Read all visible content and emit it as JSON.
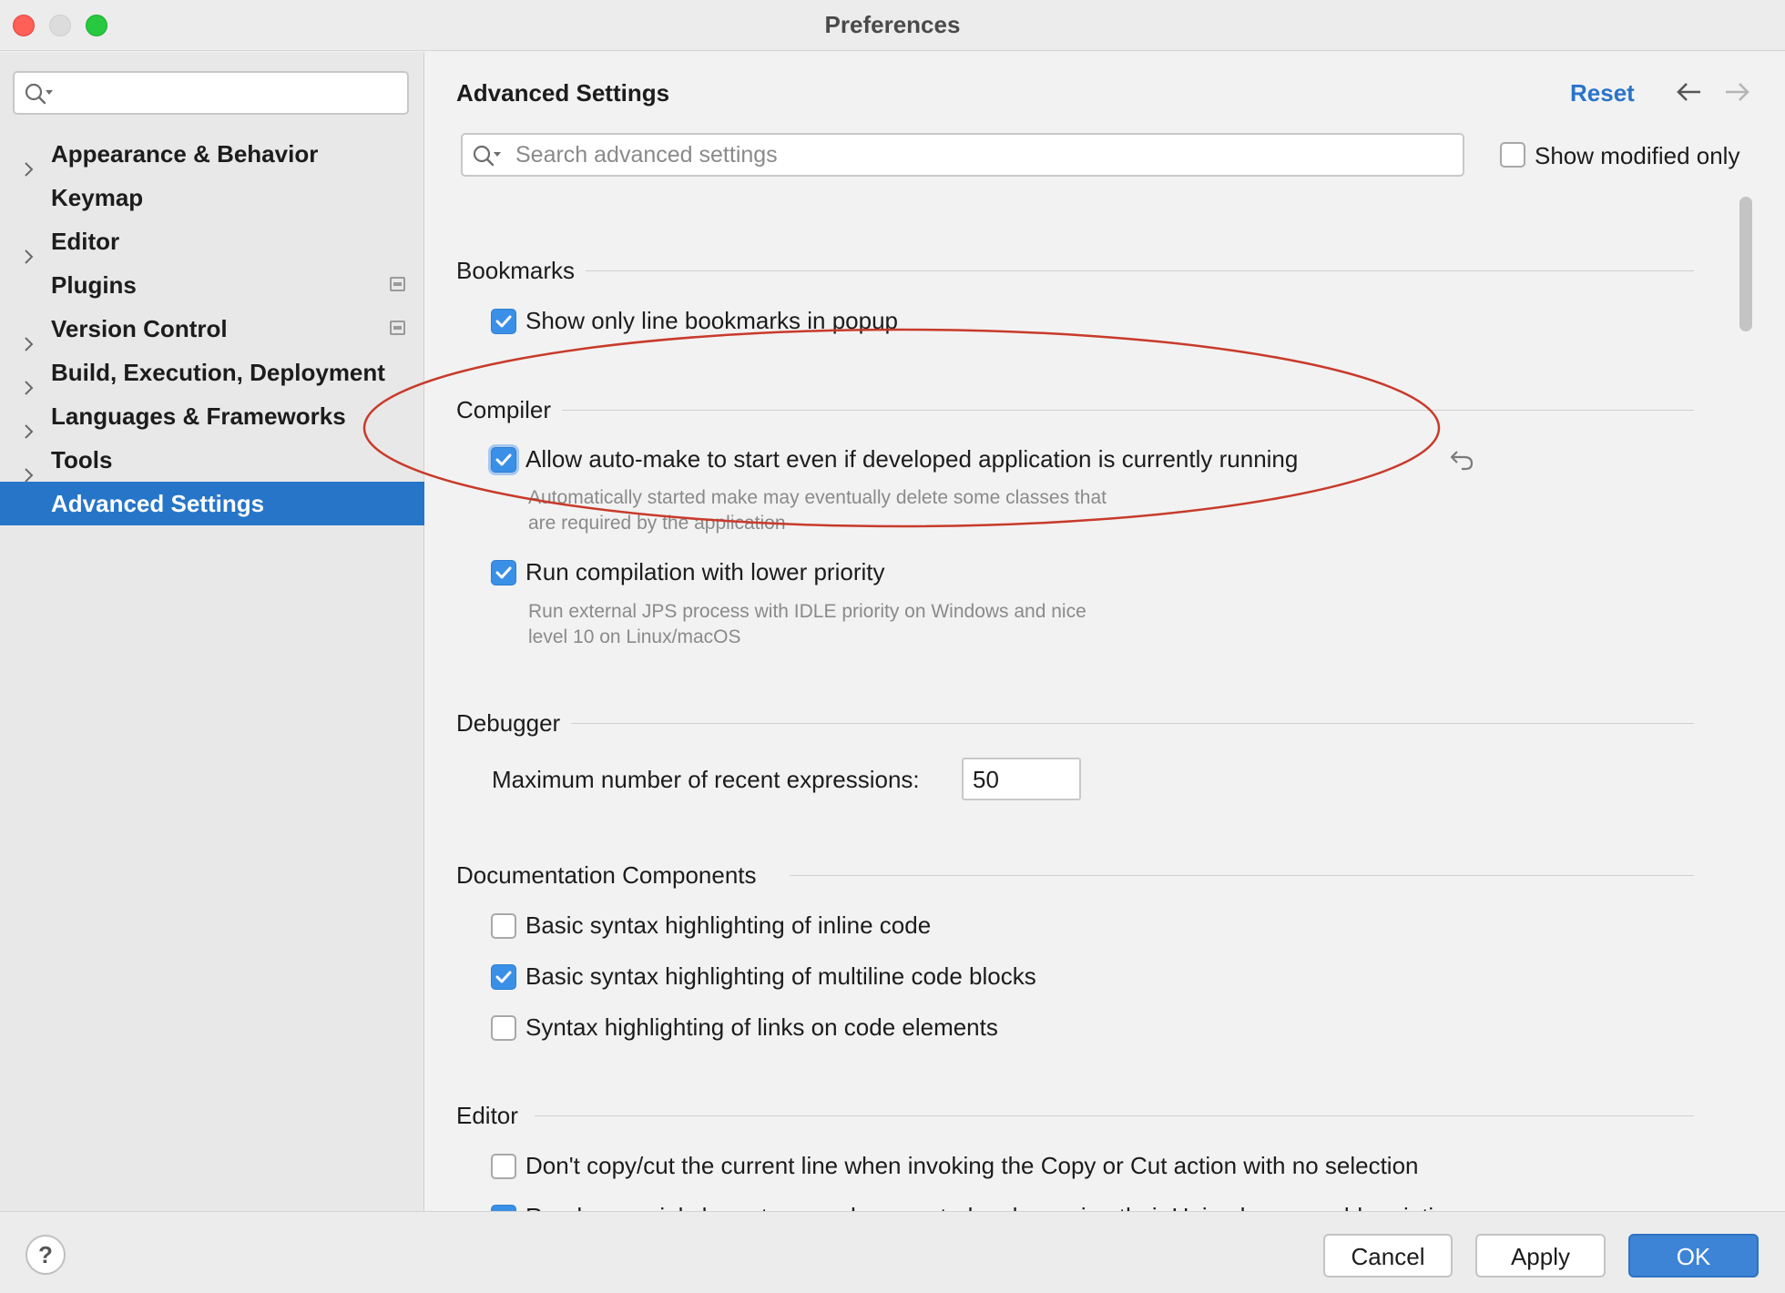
{
  "window": {
    "title": "Preferences"
  },
  "sidebar": {
    "search_value": "",
    "items": [
      {
        "label": "Appearance & Behavior",
        "expandable": true,
        "badge": false
      },
      {
        "label": "Keymap",
        "expandable": false,
        "badge": false
      },
      {
        "label": "Editor",
        "expandable": true,
        "badge": false
      },
      {
        "label": "Plugins",
        "expandable": false,
        "badge": true
      },
      {
        "label": "Version Control",
        "expandable": true,
        "badge": true
      },
      {
        "label": "Build, Execution, Deployment",
        "expandable": true,
        "badge": false
      },
      {
        "label": "Languages & Frameworks",
        "expandable": true,
        "badge": false
      },
      {
        "label": "Tools",
        "expandable": true,
        "badge": false
      },
      {
        "label": "Advanced Settings",
        "expandable": false,
        "badge": false,
        "selected": true
      }
    ]
  },
  "main": {
    "title": "Advanced Settings",
    "reset_label": "Reset",
    "search_placeholder": "Search advanced settings",
    "show_modified_only": {
      "label": "Show modified only",
      "checked": false
    }
  },
  "groups": {
    "bookmarks": {
      "title": "Bookmarks",
      "settings": [
        {
          "label": "Show only line bookmarks in popup",
          "checked": true
        }
      ]
    },
    "compiler": {
      "title": "Compiler",
      "settings": [
        {
          "label": "Allow auto-make to start even if developed application is currently running",
          "checked": true,
          "modified": true,
          "desc_line1": "Automatically started make may eventually delete some classes that",
          "desc_line2": "are required by the application"
        },
        {
          "label": "Run compilation with lower priority",
          "checked": true,
          "desc_line1": "Run external JPS process with IDLE priority on Windows and nice",
          "desc_line2": "level 10 on Linux/macOS"
        }
      ]
    },
    "debugger": {
      "title": "Debugger",
      "recent_expressions_label": "Maximum number of recent expressions:",
      "recent_expressions_value": "50"
    },
    "documentation": {
      "title": "Documentation Components",
      "settings": [
        {
          "label": "Basic syntax highlighting of inline code",
          "checked": false
        },
        {
          "label": "Basic syntax highlighting of multiline code blocks",
          "checked": true
        },
        {
          "label": "Syntax highlighting of links on code elements",
          "checked": false
        }
      ]
    },
    "editor": {
      "title": "Editor",
      "settings": [
        {
          "label": "Don't copy/cut the current line when invoking the Copy or Cut action with no selection",
          "checked": false
        },
        {
          "label": "Render special characters, such as control codes, using their Unicode name abbreviations",
          "checked": true
        }
      ]
    }
  },
  "footer": {
    "help_label": "?",
    "cancel_label": "Cancel",
    "apply_label": "Apply",
    "ok_label": "OK"
  },
  "colors": {
    "accent": "#2675c8",
    "checkbox_on": "#3a8fe6",
    "annotation": "#c83a2a",
    "link": "#2a73c9"
  },
  "icons": {
    "search": "magnifier-with-dropdown",
    "back": "arrow-left",
    "forward": "arrow-right",
    "revert": "undo-arrow",
    "chevron": "chevron-right",
    "badge": "plugin-managed-badge"
  }
}
